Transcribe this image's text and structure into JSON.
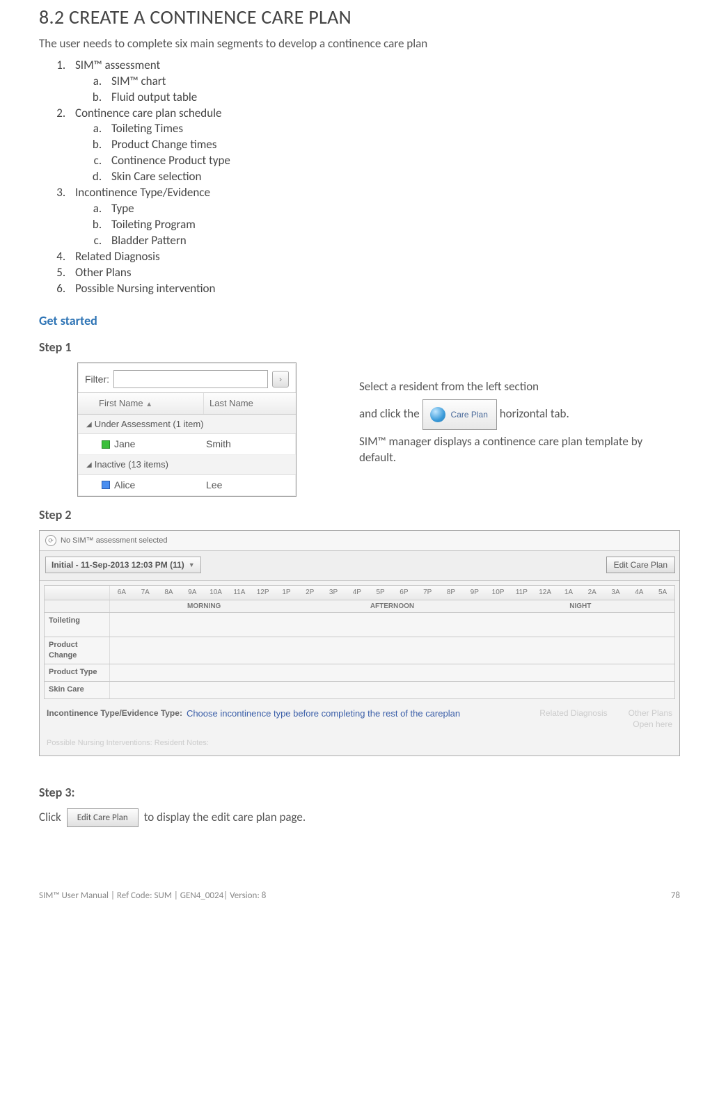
{
  "title": "8.2 CREATE A CONTINENCE CARE PLAN",
  "intro": "The user needs to complete six main segments to develop a continence care plan",
  "list": {
    "i1": "SIM™ assessment",
    "i1a": "SIM™ chart",
    "i1b": "Fluid output table",
    "i2": "Continence care plan schedule",
    "i2a": "Toileting Times",
    "i2b": "Product Change times",
    "i2c": "Continence Product type",
    "i2d": "Skin Care selection",
    "i3": "Incontinence Type/Evidence",
    "i3a": "Type",
    "i3b": "Toileting Program",
    "i3c": "Bladder Pattern",
    "i4": "Related Diagnosis",
    "i5": "Other Plans",
    "i6": "Possible Nursing intervention"
  },
  "get_started": "Get started",
  "step1_label": "Step 1",
  "step2_label": "Step 2",
  "step3_label": "Step 3:",
  "filter": {
    "label": "Filter:",
    "col_first": "First Name",
    "col_last": "Last Name",
    "group1": "Under Assessment (1 item)",
    "group2": "Inactive (13 items)",
    "r1_first": "Jane",
    "r1_last": "Smith",
    "r2_first": "Alice",
    "r2_last": "Lee"
  },
  "step1_text": {
    "line1": "Select a resident from the left section",
    "line2a": "and click the",
    "line2b": "horizontal tab.",
    "careplan_label": "Care Plan",
    "line3": "SIM™ manager displays a continence care plan template by default."
  },
  "cp": {
    "no_assess": "No SIM™ assessment selected",
    "dropdown": "Initial - 11-Sep-2013 12:03 PM (11)",
    "edit_btn": "Edit Care Plan",
    "hours": [
      "6A",
      "7A",
      "8A",
      "9A",
      "10A",
      "11A",
      "12P",
      "1P",
      "2P",
      "3P",
      "4P",
      "5P",
      "6P",
      "7P",
      "8P",
      "9P",
      "10P",
      "11P",
      "12A",
      "1A",
      "2A",
      "3A",
      "4A",
      "5A"
    ],
    "period_morning": "MORNING",
    "period_afternoon": "AFTERNOON",
    "period_night": "NIGHT",
    "row1": "Toileting",
    "row2": "Product Change",
    "row3": "Product Type",
    "row4": "Skin Care",
    "itype_label": "Incontinence Type/Evidence Type:",
    "itype_msg": "Choose incontinence type before completing the rest of the careplan",
    "related": "Related Diagnosis",
    "other": "Other Plans",
    "open": "Open here",
    "footnote": "Possible Nursing Interventions:     Resident Notes:"
  },
  "step3": {
    "click": "Click",
    "rest": "to display the edit care plan page."
  },
  "footer": {
    "left": "SIM™ User Manual | Ref Code: SUM | GEN4_0024| Version: 8",
    "right": "78"
  }
}
